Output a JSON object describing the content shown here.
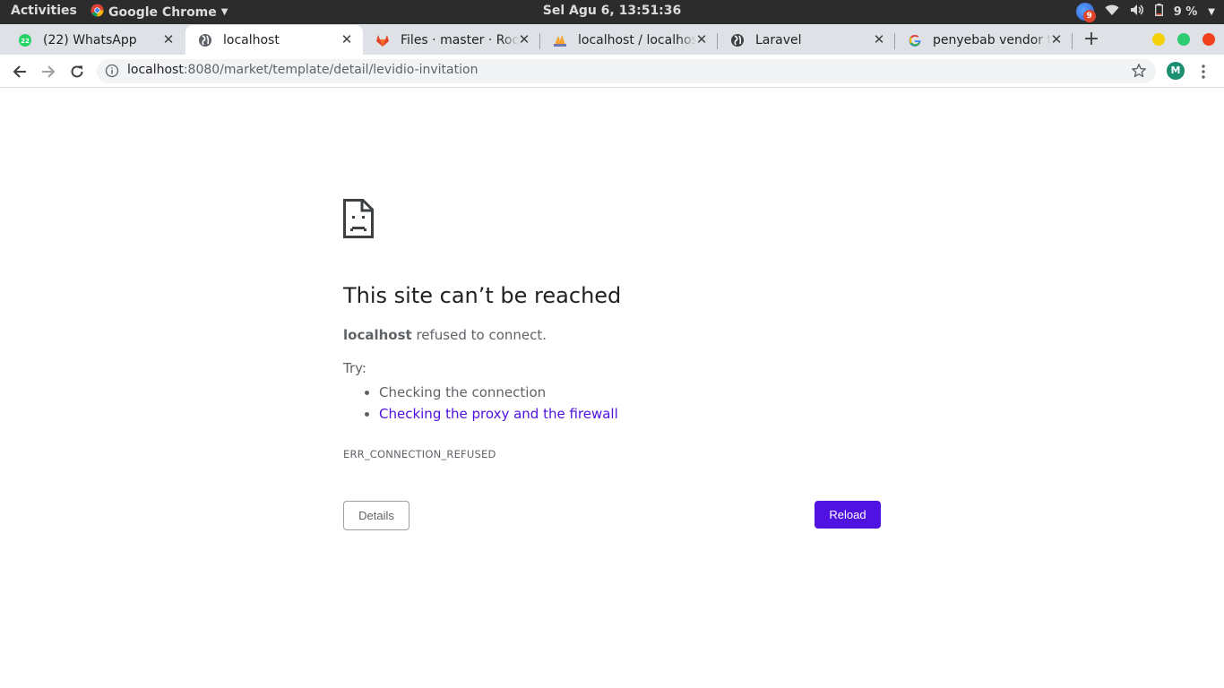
{
  "system_bar": {
    "activities": "Activities",
    "app_name": "Google Chrome",
    "clock": "Sel Agu  6, 13:51:36",
    "notification_count": "9",
    "battery": "9 %"
  },
  "tabs": [
    {
      "title": "(22) WhatsApp",
      "favicon": "whatsapp-icon",
      "badge": "22",
      "active": false
    },
    {
      "title": "localhost",
      "favicon": "globe-icon",
      "active": true
    },
    {
      "title": "Files · master · Root",
      "favicon": "gitlab-icon",
      "active": false
    },
    {
      "title": "localhost / localhost",
      "favicon": "phpmyadmin-icon",
      "active": false
    },
    {
      "title": "Laravel",
      "favicon": "globe-icon",
      "active": false
    },
    {
      "title": "penyebab vendor tidak",
      "favicon": "google-icon",
      "active": false
    }
  ],
  "toolbar": {
    "url_host": "localhost",
    "url_rest": ":8080/market/template/detail/levidio-invitation",
    "avatar_letter": "M"
  },
  "error_page": {
    "title": "This site can’t be reached",
    "host": "localhost",
    "summary_rest": " refused to connect.",
    "try_label": "Try:",
    "suggestions": [
      {
        "text": "Checking the connection",
        "link": false
      },
      {
        "text": "Checking the proxy and the firewall",
        "link": true
      }
    ],
    "error_code": "ERR_CONNECTION_REFUSED",
    "details_button": "Details",
    "reload_button": "Reload",
    "accent_color": "#4f12e0"
  },
  "window_controls": {
    "minimize_color": "#f4d20b",
    "maximize_color": "#2ecc71",
    "close_color": "#f0401e"
  }
}
